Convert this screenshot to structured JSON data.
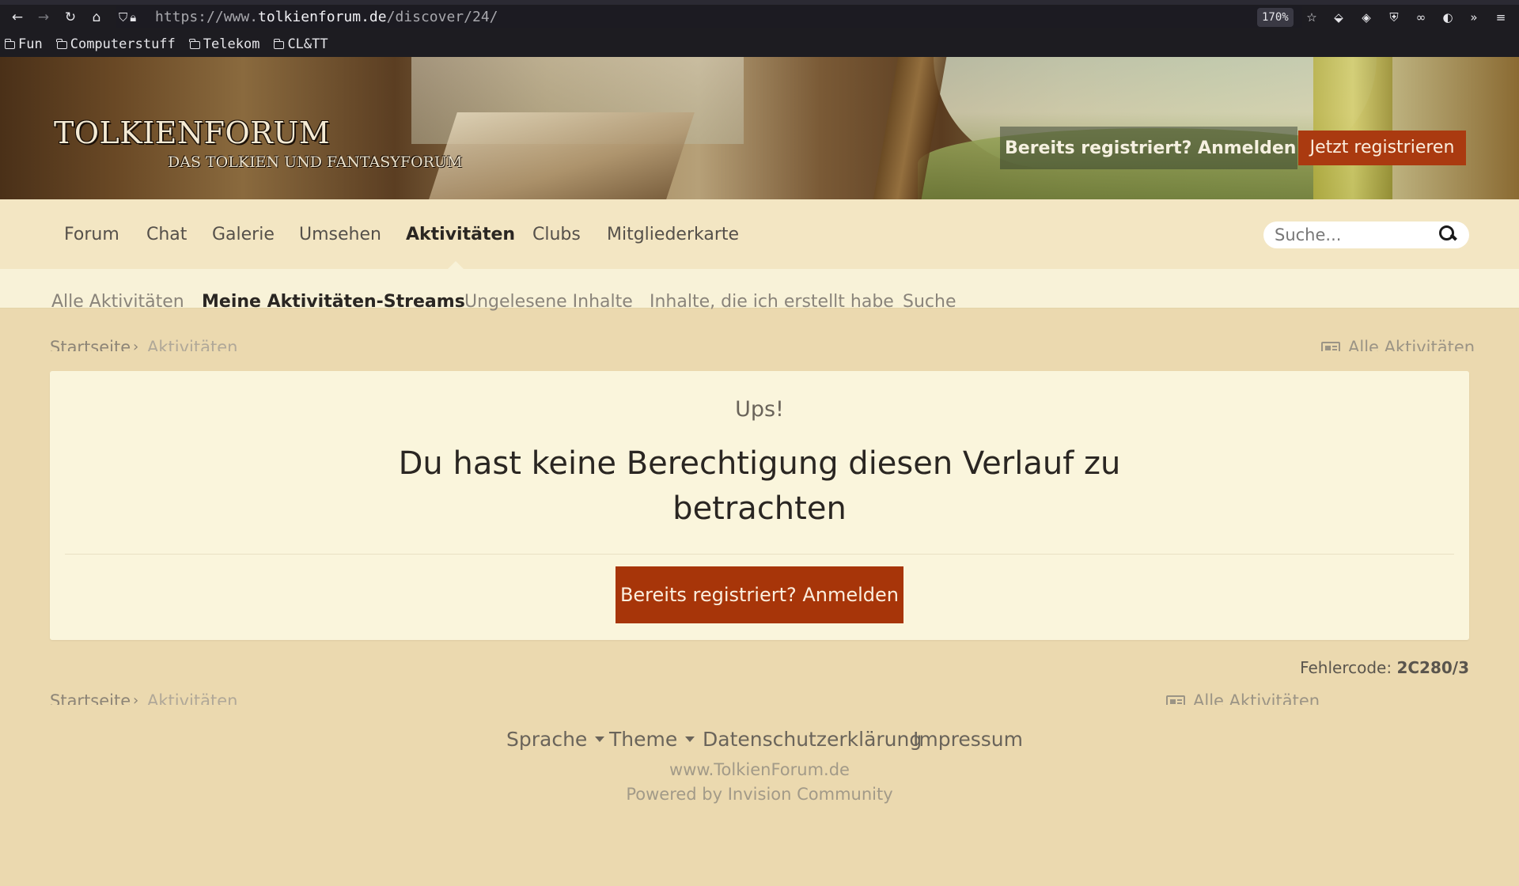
{
  "browser": {
    "url_prefix": "https://www.",
    "url_host": "tolkienforum.de",
    "url_path": "/discover/24/",
    "zoom": "170%",
    "bookmarks": [
      {
        "label": "Fun"
      },
      {
        "label": "Computerstuff"
      },
      {
        "label": "Telekom"
      },
      {
        "label": "CL&TT"
      }
    ]
  },
  "header": {
    "logo_main": "TOLKIENFORUM",
    "logo_sub": "DAS TOLKIEN UND FANTASYFORUM",
    "signin_label": "Bereits registriert? Anmelden",
    "register_label": "Jetzt registrieren"
  },
  "primary_nav": {
    "items": [
      {
        "label": "Forum"
      },
      {
        "label": "Chat"
      },
      {
        "label": "Galerie"
      },
      {
        "label": "Umsehen"
      },
      {
        "label": "Aktivitäten"
      },
      {
        "label": "Clubs"
      },
      {
        "label": "Mitgliederkarte"
      }
    ],
    "active": "Aktivitäten",
    "search_placeholder": "Suche..."
  },
  "secondary_nav": {
    "items": [
      {
        "label": "Alle Aktivitäten"
      },
      {
        "label": "Meine Aktivitäten-Streams"
      },
      {
        "label": "Ungelesene Inhalte"
      },
      {
        "label": "Inhalte, die ich erstellt habe"
      },
      {
        "label": "Suche"
      }
    ],
    "active": "Meine Aktivitäten-Streams"
  },
  "breadcrumb": {
    "home": "Startseite",
    "current": "Aktivitäten",
    "separator": "›",
    "activity_link": "Alle Aktivitäten"
  },
  "error": {
    "title": "Ups!",
    "message": "Du hast keine Berechtigung diesen Verlauf zu betrachten",
    "button_label": "Bereits registriert? Anmelden",
    "code_label": "Fehlercode:",
    "code_value": "2C280/3"
  },
  "footer": {
    "language_label": "Sprache",
    "theme_label": "Theme",
    "privacy_label": "Datenschutzerklärung",
    "imprint_label": "Impressum",
    "site": "www.TolkienForum.de",
    "powered_by": "Powered by Invision Community"
  },
  "colors": {
    "page_bg": "#ebd9af",
    "nav_bg": "#f3e6c3",
    "subnav_bg": "#f8f2d8",
    "panel_bg": "#faf5dc",
    "accent": "#a73509"
  }
}
